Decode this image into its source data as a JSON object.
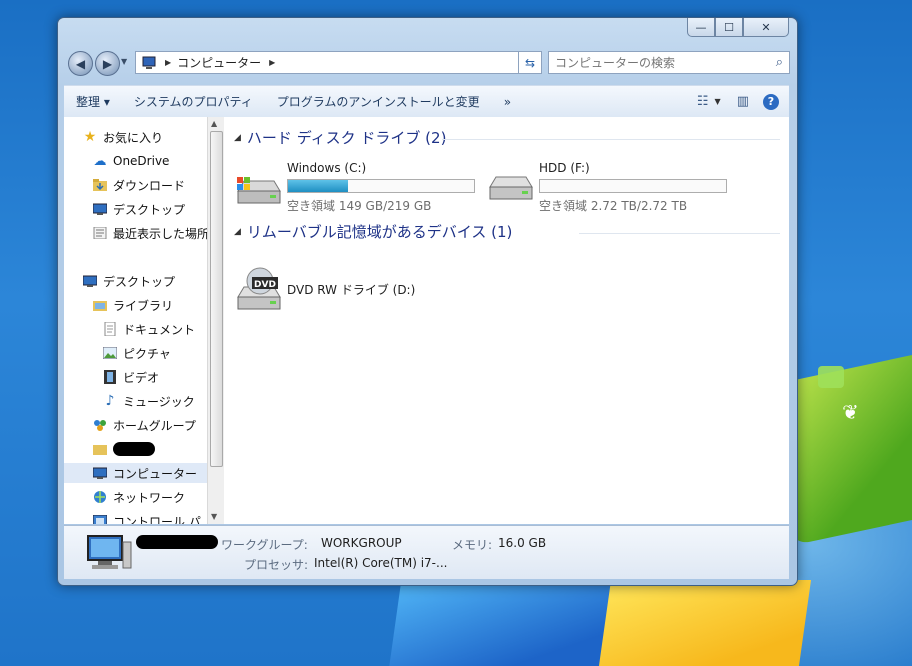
{
  "window": {
    "min_glyph": "—",
    "max_glyph": "☐",
    "close_glyph": "✕"
  },
  "address": {
    "crumb": "コンピューター"
  },
  "search": {
    "placeholder": "コンピューターの検索"
  },
  "toolbar": {
    "organize": "整理 ▾",
    "system_properties": "システムのプロパティ",
    "uninstall": "プログラムのアンインストールと変更",
    "more": "»"
  },
  "nav": {
    "favorites_header": "お気に入り",
    "favorites": [
      "OneDrive",
      "ダウンロード",
      "デスクトップ",
      "最近表示した場所"
    ],
    "desktop": "デスクトップ",
    "libraries": "ライブラリ",
    "library_items": [
      "ドキュメント",
      "ピクチャ",
      "ビデオ",
      "ミュージック"
    ],
    "homegroup": "ホームグループ",
    "computer": "コンピューター",
    "network": "ネットワーク",
    "control_panel": "コントロール パ"
  },
  "groups": {
    "hdd_header": "ハード ディスク ドライブ (2)",
    "removable_header": "リムーバブル記憶域があるデバイス (1)"
  },
  "drives": {
    "c": {
      "name": "Windows (C:)",
      "free_text": "空き領域 149 GB/219 GB",
      "used_fraction": 0.32
    },
    "f": {
      "name": "HDD (F:)",
      "free_text": "空き領域 2.72 TB/2.72 TB",
      "used_fraction": 0.0
    },
    "d": {
      "name": "DVD RW ドライブ (D:)",
      "badge": "DVD"
    }
  },
  "details": {
    "workgroup_label": "ワークグループ:",
    "workgroup_value": "WORKGROUP",
    "memory_label": "メモリ:",
    "memory_value": "16.0 GB",
    "processor_label": "プロセッサ:",
    "processor_value": "Intel(R) Core(TM) i7-..."
  },
  "colors": {
    "accent": "#1e3287",
    "drive_bar": "#1f8fc2"
  },
  "icons": [
    "back-icon",
    "forward-icon",
    "computer-icon",
    "refresh-icon",
    "search-icon",
    "view-icon",
    "preview-pane-icon",
    "help-icon",
    "star-icon",
    "cloud-icon",
    "folder-icon",
    "desktop-icon",
    "library-icon",
    "document-icon",
    "picture-icon",
    "video-icon",
    "music-icon",
    "homegroup-icon",
    "network-icon",
    "control-panel-icon",
    "hard-drive-icon",
    "dvd-drive-icon"
  ]
}
